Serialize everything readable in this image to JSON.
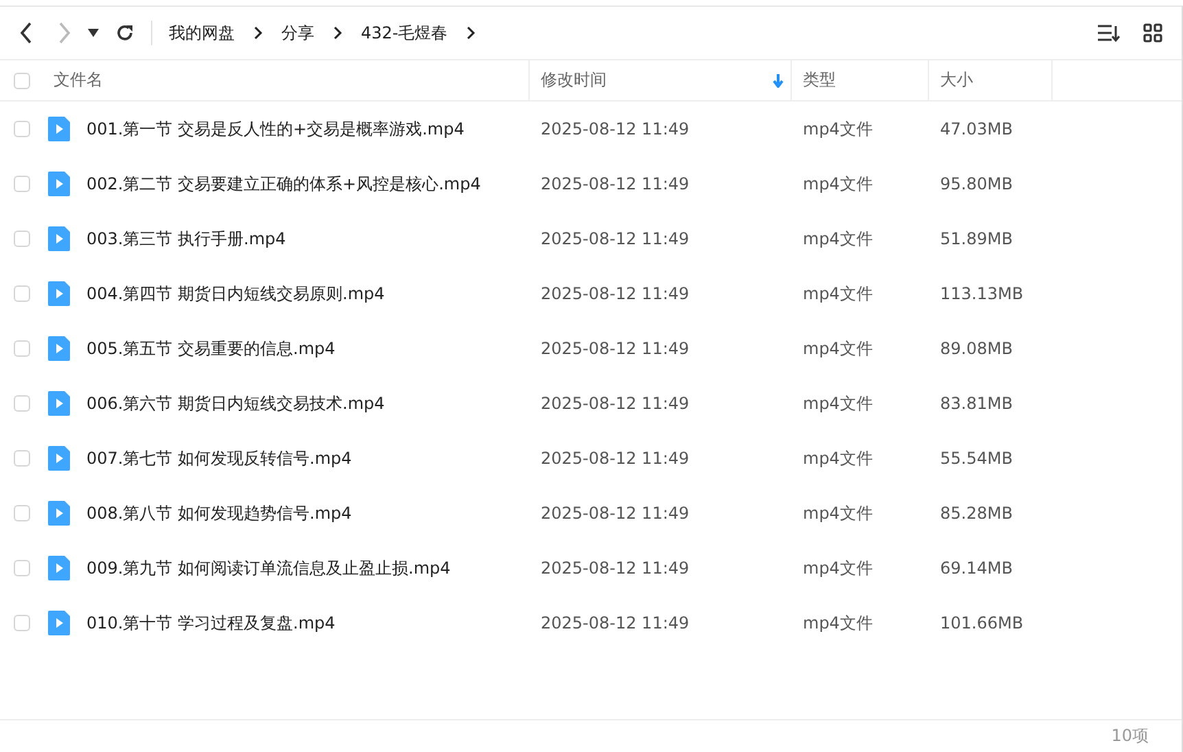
{
  "toolbar": {
    "back": {
      "disabled": false
    },
    "forward": {
      "disabled": true
    }
  },
  "breadcrumb": [
    "我的网盘",
    "分享",
    "432-毛煜春"
  ],
  "table": {
    "select_all": {
      "checked": false
    },
    "columns": [
      {
        "label": "文件名",
        "sorted": false
      },
      {
        "label": "修改时间",
        "sorted": true
      },
      {
        "label": "类型",
        "sorted": false
      },
      {
        "label": "大小",
        "sorted": false
      }
    ],
    "rows": [
      {
        "checked": false,
        "name": "001.第一节 交易是反人性的+交易是概率游戏.mp4",
        "modified": "2025-08-12 11:49",
        "type": "mp4文件",
        "size": "47.03MB"
      },
      {
        "checked": false,
        "name": "002.第二节 交易要建立正确的体系+风控是核心.mp4",
        "modified": "2025-08-12 11:49",
        "type": "mp4文件",
        "size": "95.80MB"
      },
      {
        "checked": false,
        "name": "003.第三节 执行手册.mp4",
        "modified": "2025-08-12 11:49",
        "type": "mp4文件",
        "size": "51.89MB"
      },
      {
        "checked": false,
        "name": "004.第四节 期货日内短线交易原则.mp4",
        "modified": "2025-08-12 11:49",
        "type": "mp4文件",
        "size": "113.13MB"
      },
      {
        "checked": false,
        "name": "005.第五节 交易重要的信息.mp4",
        "modified": "2025-08-12 11:49",
        "type": "mp4文件",
        "size": "89.08MB"
      },
      {
        "checked": false,
        "name": "006.第六节 期货日内短线交易技术.mp4",
        "modified": "2025-08-12 11:49",
        "type": "mp4文件",
        "size": "83.81MB"
      },
      {
        "checked": false,
        "name": "007.第七节 如何发现反转信号.mp4",
        "modified": "2025-08-12 11:49",
        "type": "mp4文件",
        "size": "55.54MB"
      },
      {
        "checked": false,
        "name": "008.第八节 如何发现趋势信号.mp4",
        "modified": "2025-08-12 11:49",
        "type": "mp4文件",
        "size": "85.28MB"
      },
      {
        "checked": false,
        "name": "009.第九节 如何阅读订单流信息及止盈止损.mp4",
        "modified": "2025-08-12 11:49",
        "type": "mp4文件",
        "size": "69.14MB"
      },
      {
        "checked": false,
        "name": "010.第十节 学习过程及复盘.mp4",
        "modified": "2025-08-12 11:49",
        "type": "mp4文件",
        "size": "101.66MB"
      }
    ]
  },
  "status_bar": {
    "count": "10项"
  }
}
